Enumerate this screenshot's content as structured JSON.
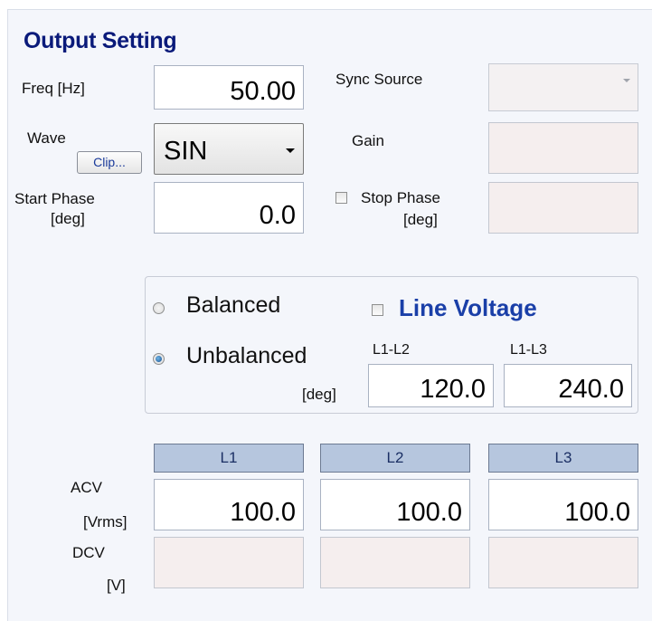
{
  "output_setting": {
    "title": "Output Setting",
    "freq": {
      "label": "Freq [Hz]",
      "value": "50.00"
    },
    "wave": {
      "label": "Wave",
      "clip_button": "Clip...",
      "selected": "SIN"
    },
    "start_phase": {
      "label_line1": "Start Phase",
      "label_line2": "[deg]",
      "value": "0.0"
    },
    "sync_source": {
      "label": "Sync Source",
      "value": ""
    },
    "gain": {
      "label": "Gain",
      "value": ""
    },
    "stop_phase": {
      "label_line1": "Stop Phase",
      "label_line2": "[deg]",
      "checked": false,
      "value": ""
    }
  },
  "balance": {
    "balanced_label": "Balanced",
    "unbalanced_label": "Unbalanced",
    "selected": "Unbalanced",
    "deg_label": "[deg]",
    "line_voltage_label": "Line Voltage",
    "line_voltage_checked": false,
    "l1_l2": {
      "label": "L1-L2",
      "value": "120.0"
    },
    "l1_l3": {
      "label": "L1-L3",
      "value": "240.0"
    }
  },
  "phases": {
    "headers": [
      "L1",
      "L2",
      "L3"
    ],
    "acv": {
      "label_line1": "ACV",
      "label_line2": "[Vrms]",
      "values": [
        "100.0",
        "100.0",
        "100.0"
      ]
    },
    "dcv": {
      "label_line1": "DCV",
      "label_line2": "[V]",
      "values": [
        "",
        "",
        ""
      ]
    }
  },
  "colors": {
    "title": "#0a1a7a",
    "line_voltage": "#1a3fa8",
    "phase_header_bg": "#b6c6de",
    "disabled_field_bg": "#f5eeee"
  }
}
